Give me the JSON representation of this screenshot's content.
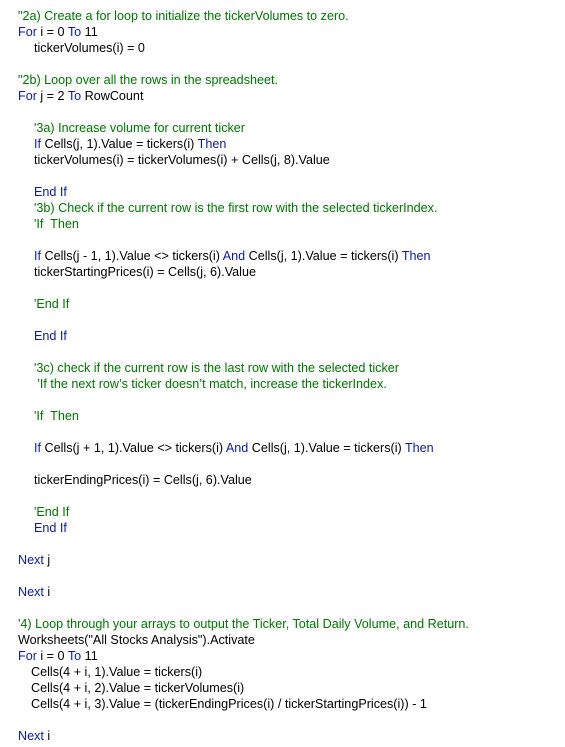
{
  "editor": {
    "theme": {
      "comment_color": "#007400",
      "keyword_color": "#0b1aa8",
      "text_color": "#000000",
      "background_color": "#ffffff"
    },
    "lines": [
      {
        "indent": 0,
        "tokens": [
          {
            "t": "c",
            "v": "\"2a) Create a for loop to initialize the tickerVolumes to zero."
          }
        ]
      },
      {
        "indent": 0,
        "tokens": [
          {
            "t": "k",
            "v": "For"
          },
          {
            "t": "p",
            "v": " i = 0 "
          },
          {
            "t": "k",
            "v": "To"
          },
          {
            "t": "p",
            "v": " 11"
          }
        ]
      },
      {
        "indent": 1,
        "tokens": [
          {
            "t": "p",
            "v": "tickerVolumes(i) = 0"
          }
        ]
      },
      {
        "indent": 0,
        "tokens": [
          {
            "t": "c",
            "v": "\"2b) Loop over all the rows in the spreadsheet."
          }
        ]
      },
      {
        "indent": 0,
        "tokens": [
          {
            "t": "k",
            "v": "For"
          },
          {
            "t": "p",
            "v": " j = 2 "
          },
          {
            "t": "k",
            "v": "To"
          },
          {
            "t": "p",
            "v": " RowCount"
          }
        ]
      },
      {
        "indent": 1,
        "tokens": [
          {
            "t": "c",
            "v": "'3a) Increase volume for current ticker"
          }
        ]
      },
      {
        "indent": 1,
        "tokens": [
          {
            "t": "k",
            "v": "If"
          },
          {
            "t": "p",
            "v": " Cells(j, 1).Value = tickers(i) "
          },
          {
            "t": "k",
            "v": "Then"
          }
        ]
      },
      {
        "indent": 1,
        "tokens": [
          {
            "t": "p",
            "v": "tickerVolumes(i) = tickerVolumes(i) + Cells(j, 8).Value"
          }
        ]
      },
      {
        "indent": 1,
        "tokens": [
          {
            "t": "k",
            "v": "End If"
          }
        ]
      },
      {
        "indent": 1,
        "tokens": [
          {
            "t": "c",
            "v": "'3b) Check if the current row is the first row with the selected tickerIndex."
          }
        ]
      },
      {
        "indent": 1,
        "tokens": [
          {
            "t": "c",
            "v": "'If  Then"
          }
        ]
      },
      {
        "indent": 1,
        "tokens": [
          {
            "t": "k",
            "v": "If"
          },
          {
            "t": "p",
            "v": " Cells(j - 1, 1).Value <> tickers(i) "
          },
          {
            "t": "k",
            "v": "And"
          },
          {
            "t": "p",
            "v": " Cells(j, 1).Value = tickers(i) "
          },
          {
            "t": "k",
            "v": "Then"
          }
        ]
      },
      {
        "indent": 1,
        "tokens": [
          {
            "t": "p",
            "v": "tickerStartingPrices(i) = Cells(j, 6).Value"
          }
        ]
      },
      {
        "indent": 1,
        "tokens": [
          {
            "t": "c",
            "v": "'End If"
          }
        ]
      },
      {
        "indent": 1,
        "tokens": [
          {
            "t": "k",
            "v": "End If"
          }
        ]
      },
      {
        "indent": 1,
        "tokens": [
          {
            "t": "c",
            "v": "'3c) check if the current row is the last row with the selected ticker"
          }
        ]
      },
      {
        "indent": 1,
        "tokens": [
          {
            "t": "c",
            "v": " 'If the next row’s ticker doesn’t match, increase the tickerIndex."
          }
        ]
      },
      {
        "indent": 1,
        "tokens": [
          {
            "t": "c",
            "v": "'If  Then"
          }
        ]
      },
      {
        "indent": 1,
        "tokens": [
          {
            "t": "k",
            "v": "If"
          },
          {
            "t": "p",
            "v": " Cells(j + 1, 1).Value <> tickers(i) "
          },
          {
            "t": "k",
            "v": "And"
          },
          {
            "t": "p",
            "v": " Cells(j, 1).Value = tickers(i) "
          },
          {
            "t": "k",
            "v": "Then"
          }
        ]
      },
      {
        "indent": 1,
        "tokens": [
          {
            "t": "p",
            "v": "tickerEndingPrices(i) = Cells(j, 6).Value"
          }
        ]
      },
      {
        "indent": 1,
        "tokens": [
          {
            "t": "c",
            "v": "'End If"
          }
        ]
      },
      {
        "indent": 1,
        "tokens": [
          {
            "t": "k",
            "v": "End If"
          }
        ]
      },
      {
        "indent": 0,
        "tokens": [
          {
            "t": "k",
            "v": "Next"
          },
          {
            "t": "p",
            "v": " j"
          }
        ]
      },
      {
        "indent": 0,
        "tokens": [
          {
            "t": "k",
            "v": "Next"
          },
          {
            "t": "p",
            "v": " i"
          }
        ]
      },
      {
        "indent": 0,
        "tokens": [
          {
            "t": "c",
            "v": "'4) Loop through your arrays to output the Ticker, Total Daily Volume, and Return."
          }
        ]
      },
      {
        "indent": 0,
        "tokens": [
          {
            "t": "p",
            "v": "Worksheets(\"All Stocks Analysis\").Activate"
          }
        ]
      },
      {
        "indent": 0,
        "tokens": [
          {
            "t": "k",
            "v": "For"
          },
          {
            "t": "p",
            "v": " i = 0 "
          },
          {
            "t": "k",
            "v": "To"
          },
          {
            "t": "p",
            "v": " 11"
          }
        ]
      },
      {
        "indent": 2,
        "tokens": [
          {
            "t": "p",
            "v": "Cells(4 + i, 1).Value = tickers(i)"
          }
        ]
      },
      {
        "indent": 2,
        "tokens": [
          {
            "t": "p",
            "v": "Cells(4 + i, 2).Value = tickerVolumes(i)"
          }
        ]
      },
      {
        "indent": 2,
        "tokens": [
          {
            "t": "p",
            "v": "Cells(4 + i, 3).Value = (tickerEndingPrices(i) / tickerStartingPrices(i)) - 1"
          }
        ]
      },
      {
        "indent": 0,
        "tokens": [
          {
            "t": "k",
            "v": "Next"
          },
          {
            "t": "p",
            "v": " i"
          }
        ]
      }
    ]
  }
}
